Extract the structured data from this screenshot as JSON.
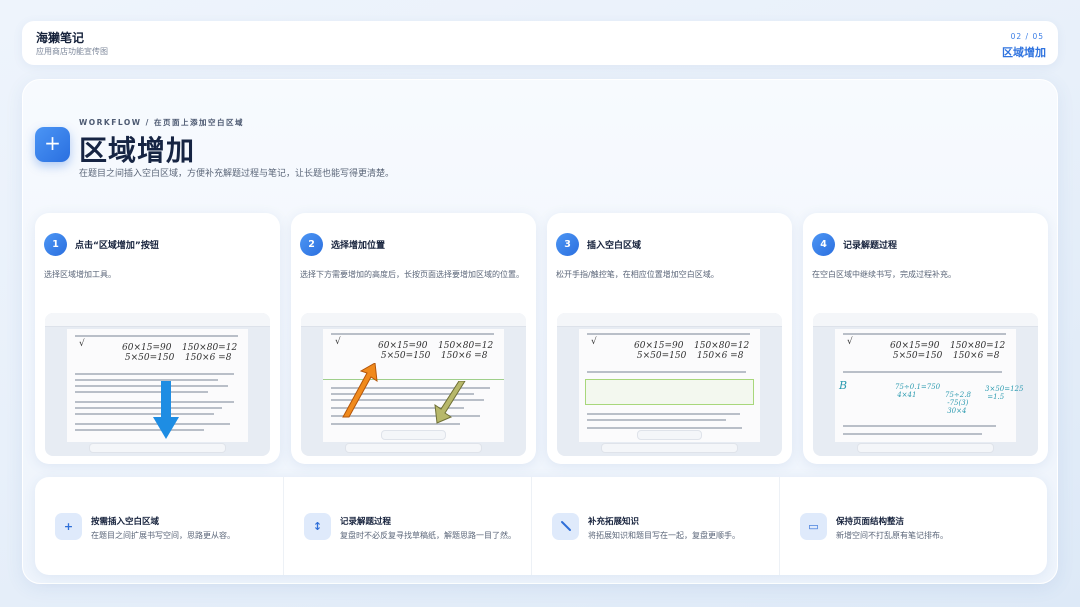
{
  "header": {
    "app_name": "海獭笔记",
    "app_sub": "应用商店功能宣传图",
    "page_num": "02 / 05",
    "page_title": "区域增加"
  },
  "hero": {
    "icon": "plus-icon",
    "workflow": "WORKFLOW / 在页面上添加空白区域",
    "title": "区域增加",
    "desc": "在题目之间插入空白区域，方便补充解题过程与笔记，让长题也能写得更清楚。"
  },
  "steps": [
    {
      "num": "1",
      "title": "点击“区域增加”按钮",
      "desc": "选择区域增加工具。"
    },
    {
      "num": "2",
      "title": "选择增加位置",
      "desc": "选择下方需要增加的高度后，长按页面选择要增加区域的位置。"
    },
    {
      "num": "3",
      "title": "插入空白区域",
      "desc": "松开手指/触控笔，在相应位置增加空白区域。"
    },
    {
      "num": "4",
      "title": "记录解题过程",
      "desc": "在空白区域中继续书写，完成过程补充。"
    }
  ],
  "features": [
    {
      "icon": "plus-icon",
      "title": "按需插入空白区域",
      "desc": "在题目之间扩展书写空间，思路更从容。"
    },
    {
      "icon": "resize-vertical-icon",
      "title": "记录解题过程",
      "desc": "复盘时不必反复寻找草稿纸，解题思路一目了然。"
    },
    {
      "icon": "pen-icon",
      "title": "补充拓展知识",
      "desc": "将拓展知识和题目写在一起，复盘更顺手。"
    },
    {
      "icon": "layout-icon",
      "title": "保持页面结构整洁",
      "desc": "新增空间不打乱原有笔记排布。"
    }
  ],
  "colors": {
    "accent": "#2f73df",
    "highlight_box": "#a8d77b",
    "arrow_blue": "#1e8de3",
    "arrow_orange": "#f08a1c",
    "arrow_olive": "#b7b86a"
  }
}
